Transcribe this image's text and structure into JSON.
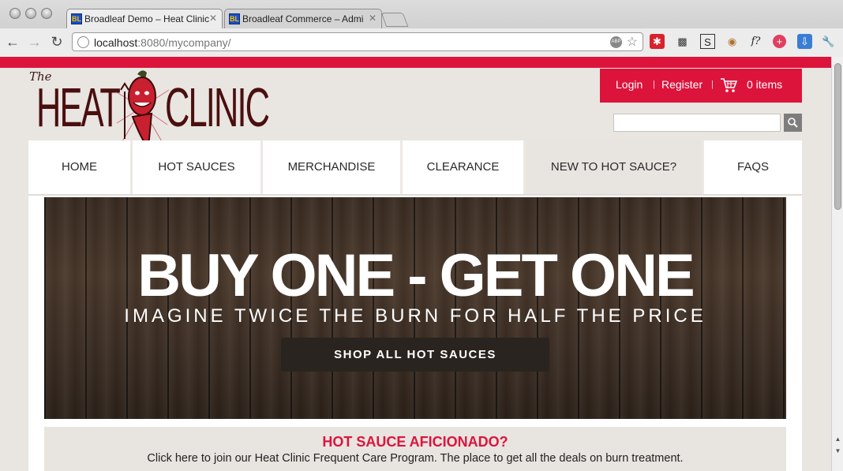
{
  "browser": {
    "tabs": [
      {
        "label": "Broadleaf Demo – Heat Clinic",
        "favicon": "BL",
        "close": "✕"
      },
      {
        "label": "Broadleaf Commerce – Admi",
        "favicon": "BL",
        "close": "✕"
      }
    ],
    "url_host": "localhost",
    "url_rest": ":8080/mycompany/",
    "abp": "ABP"
  },
  "header": {
    "logo_the": "The",
    "logo_heat": "HEAT",
    "logo_clinic": "CLINIC",
    "login": "Login",
    "separator": "|",
    "register": "Register",
    "cart_count": "0 items",
    "search_placeholder": ""
  },
  "nav": {
    "items": [
      {
        "label": "HOME"
      },
      {
        "label": "HOT SAUCES"
      },
      {
        "label": "MERCHANDISE"
      },
      {
        "label": "CLEARANCE"
      },
      {
        "label": "NEW TO HOT SAUCE?"
      },
      {
        "label": "FAQS"
      }
    ]
  },
  "banner": {
    "headline": "BUY ONE - GET ONE",
    "subhead": "IMAGINE TWICE THE BURN FOR HALF THE PRICE",
    "cta": "SHOP ALL HOT SAUCES"
  },
  "promo": {
    "title": "HOT SAUCE AFICIONADO?",
    "text": "Click here to join our Heat Clinic Frequent Care Program. The place to get all the deals on burn treatment."
  },
  "colors": {
    "brand_red": "#dc143c",
    "logo_brown": "#4a0f0f"
  }
}
